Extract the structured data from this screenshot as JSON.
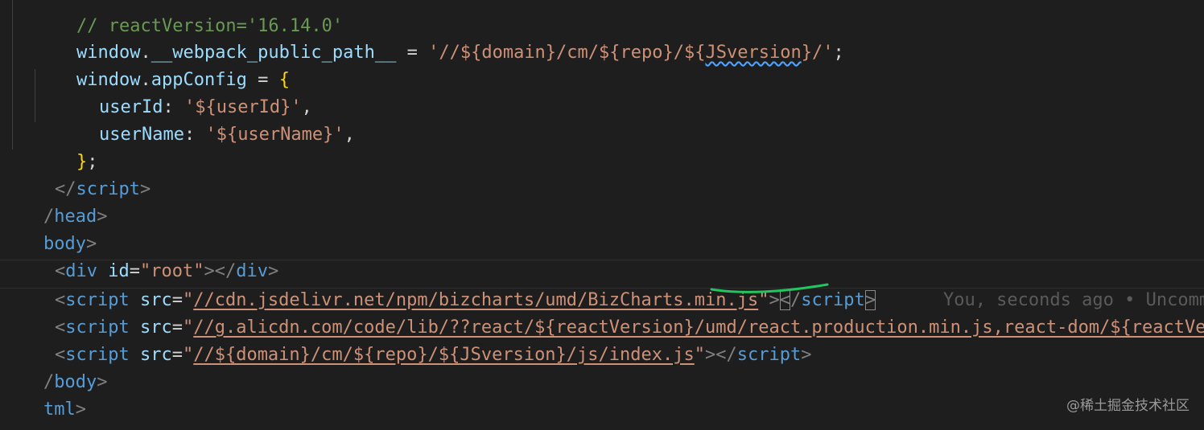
{
  "code": {
    "l0": {
      "comment": "// reactVersion='16.14.0'"
    },
    "l1": {
      "window": "window",
      "dot": ".",
      "prop": "__webpack_public_path__",
      "eq": " = ",
      "str_a": "'//${domain}/cm/${repo}/${",
      "str_sq": "JSversion",
      "str_b": "}/'",
      "semi": ";"
    },
    "l2": {
      "window": "window",
      "dot": ".",
      "prop": "appConfig",
      "eq": " = ",
      "brace": "{"
    },
    "l3": {
      "key": "userId",
      "colon": ": ",
      "value": "'${userId}'",
      "comma": ","
    },
    "l4": {
      "key": "userName",
      "colon": ": ",
      "value": "'${userName}'",
      "comma": ","
    },
    "l5": {
      "brace": "}",
      "semi": ";"
    },
    "l6": {
      "open": "</",
      "tag": "script",
      "close": ">"
    },
    "l7": {
      "open": "/",
      "tag": "head",
      "close": ">"
    },
    "l8": {
      "tag": "body",
      "close": ">"
    },
    "l9": {
      "open": "<",
      "tag": "div",
      "attr": "id",
      "eq": "=",
      "q1": "\"",
      "value": "root",
      "q2": "\"",
      "gt": "></",
      "endtag": "div",
      "close": ">"
    },
    "l10": {
      "open": "<",
      "tag": "script",
      "attr": "src",
      "eq": "=",
      "q1": "\"",
      "url": "//cdn.jsdelivr.net/npm/bizcharts/umd/BizCharts.min.js",
      "q2": "\"",
      "gt": ">",
      "lt": "<",
      "slash": "/",
      "endtag": "script",
      "close": ">",
      "blame": "You, seconds ago • Uncommitted changes"
    },
    "l11": {
      "open": "<",
      "tag": "script",
      "attr": "src",
      "eq": "=",
      "q1": "\"",
      "url": "//g.alicdn.com/code/lib/??react/${reactVersion}/umd/react.production.min.js,react-dom/${reactVersion}/umd/react-dom.production.min.js"
    },
    "l12": {
      "open": "<",
      "tag": "script",
      "attr": "src",
      "eq": "=",
      "q1": "\"",
      "url": "//${domain}/cm/${repo}/${JSversion}/js/index.js",
      "q2": "\"",
      "gt": "></",
      "endtag": "script",
      "close": ">"
    },
    "l13": {
      "open": "/",
      "tag": "body",
      "close": ">"
    },
    "l14": {
      "tag": "tml",
      "close": ">"
    }
  },
  "watermark": "@稀土掘金技术社区",
  "colors": {
    "background": "#1e1e1e",
    "tag": "#569cd6",
    "attribute": "#9cdcfe",
    "string": "#ce9178",
    "brace": "#ffd700",
    "annotation": "#22c55e"
  }
}
